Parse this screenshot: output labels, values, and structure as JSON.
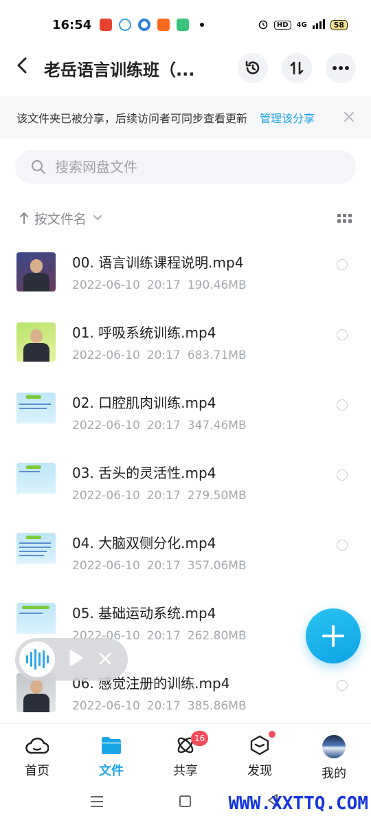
{
  "status_bar": {
    "time": "16:54",
    "app_icons": [
      {
        "name": "toutiao-app-icon",
        "color": "#e8412f",
        "label": "头条"
      },
      {
        "name": "cloud-app-icon",
        "color": "#3aa0ea"
      },
      {
        "name": "circle-app-icon",
        "color": "#2b7fd9"
      },
      {
        "name": "taobao-app-icon",
        "color": "#ff6a1a",
        "label": "淘"
      },
      {
        "name": "wechat-app-icon",
        "color": "#3ac47b"
      }
    ],
    "hd": "HD",
    "network": "4G",
    "battery": "58"
  },
  "header": {
    "title": "老岳语言训练班（...",
    "back_icon": "chevron-left-icon",
    "history_icon": "history-icon",
    "sort_icon": "sort-arrows-icon",
    "more_icon": "more-dots-icon"
  },
  "share_banner": {
    "text": "该文件夹已被分享，后续访问者可同步查看更新",
    "link": "管理该分享",
    "close_icon": "close-icon"
  },
  "search": {
    "placeholder": "搜索网盘文件",
    "value": ""
  },
  "sort": {
    "label": "按文件名",
    "direction_icon": "arrow-up-icon",
    "view_icon": "grid-view-icon"
  },
  "files": [
    {
      "name": "00. 语言训练课程说明.mp4",
      "date": "2022-06-10",
      "time": "20:17",
      "size": "190.46MB",
      "thumb": "person-p1"
    },
    {
      "name": "01. 呼吸系统训练.mp4",
      "date": "2022-06-10",
      "time": "20:17",
      "size": "683.71MB",
      "thumb": "person-p2"
    },
    {
      "name": "02. 口腔肌肉训练.mp4",
      "date": "2022-06-10",
      "time": "20:17",
      "size": "347.46MB",
      "thumb": "slide"
    },
    {
      "name": "03. 舌头的灵活性.mp4",
      "date": "2022-06-10",
      "time": "20:17",
      "size": "279.50MB",
      "thumb": "slide"
    },
    {
      "name": "04. 大脑双侧分化.mp4",
      "date": "2022-06-10",
      "time": "20:17",
      "size": "357.06MB",
      "thumb": "slide"
    },
    {
      "name": "05. 基础运动系统.mp4",
      "date": "2022-06-10",
      "time": "20:17",
      "size": "262.80MB",
      "thumb": "slide"
    },
    {
      "name": "06. 感觉注册的训练.mp4",
      "date": "2022-06-10",
      "time": "20:17",
      "size": "385.86MB",
      "thumb": "person-p3"
    }
  ],
  "fab": {
    "icon": "plus-icon",
    "color": "#1aa5e8"
  },
  "player": {
    "wave_icon": "audio-wave-icon",
    "play_icon": "play-icon",
    "close_icon": "close-icon"
  },
  "bottom_nav": {
    "items": [
      {
        "label": "首页",
        "icon": "cloud-home-icon"
      },
      {
        "label": "文件",
        "icon": "folder-icon",
        "active": true
      },
      {
        "label": "共享",
        "icon": "atom-share-icon",
        "badge": "16"
      },
      {
        "label": "发现",
        "icon": "cube-discover-icon",
        "dot": true
      },
      {
        "label": "我的",
        "icon": "avatar"
      }
    ]
  },
  "watermark": "WWW.XXTTQ.COM"
}
